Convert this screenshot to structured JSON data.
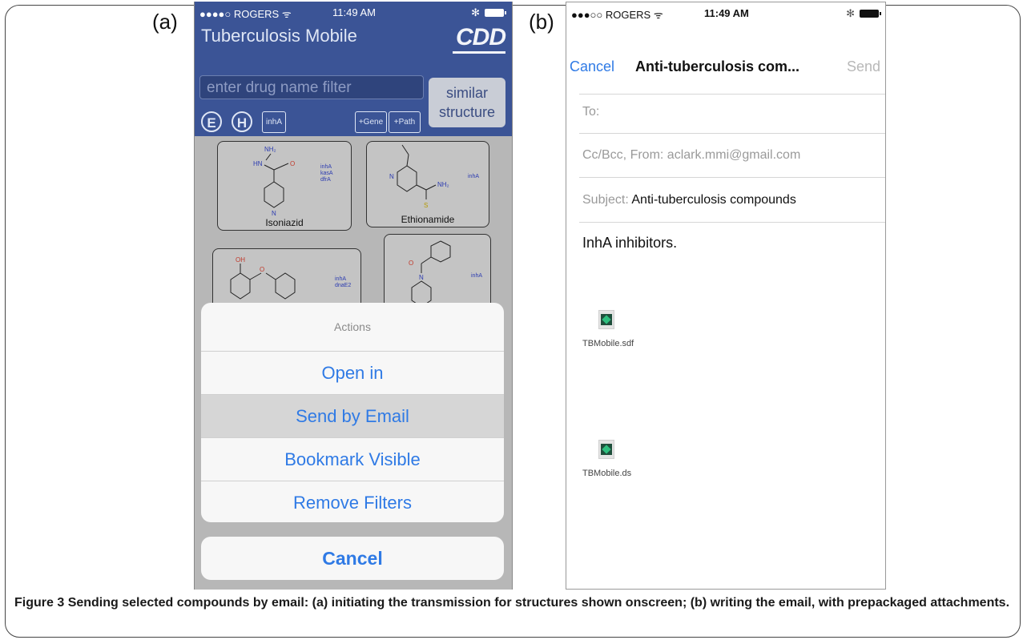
{
  "panels": {
    "a_label": "(a)",
    "b_label": "(b)"
  },
  "phone_a": {
    "status": {
      "carrier": "●●●●○ ROGERS ᯤ",
      "time": "11:49 AM",
      "bluetooth": "✻"
    },
    "app_title": "Tuberculosis Mobile",
    "logo": "CDD",
    "filter_placeholder": "enter drug name filter",
    "similar_button": {
      "line1": "similar",
      "line2": "structure"
    },
    "filter_buttons": {
      "e": "E",
      "h": "H",
      "inha": "inhA",
      "gene": "+Gene",
      "path": "+Path"
    },
    "compounds": [
      {
        "name": "Isoniazid",
        "genes": "inhA\nkasA\ndfrA"
      },
      {
        "name": "Ethionamide",
        "genes": "inhA"
      },
      {
        "name": "",
        "genes": "inhA\ndnaE2"
      },
      {
        "name": "",
        "genes": "inhA"
      }
    ],
    "actions": {
      "title": "Actions",
      "items": [
        "Open in",
        "Send by Email",
        "Bookmark Visible",
        "Remove Filters"
      ],
      "selected_index": 1,
      "cancel": "Cancel"
    }
  },
  "phone_b": {
    "status": {
      "carrier": "●●●○○ ROGERS ᯤ",
      "time": "11:49 AM",
      "bluetooth": "✻"
    },
    "nav": {
      "cancel": "Cancel",
      "title": "Anti-tuberculosis com...",
      "send": "Send"
    },
    "to_label": "To:",
    "cc_label": "Cc/Bcc, From:",
    "cc_value": "aclark.mmi@gmail.com",
    "subject_label": "Subject:",
    "subject_value": "Anti-tuberculosis compounds",
    "body": "InhA inhibitors.",
    "attachments": [
      "TBMobile.sdf",
      "TBMobile.ds"
    ]
  },
  "caption": {
    "label": "Figure 3",
    "text": "Sending selected compounds by email: (a) initiating the transmission for structures shown onscreen; (b) writing the email, with prepackaged attachments."
  },
  "colors": {
    "accent_blue": "#2f7ae5",
    "header_blue": "#3b5496"
  }
}
